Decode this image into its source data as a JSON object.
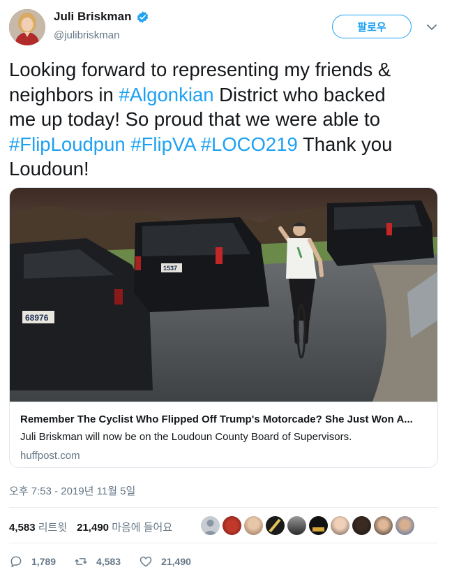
{
  "user": {
    "name": "Juli Briskman",
    "handle": "@julibriskman",
    "follow_label": "팔로우"
  },
  "tweet": {
    "lines": [
      [
        {
          "t": "Looking forward to representing my friends &"
        }
      ],
      [
        {
          "t": "neighbors in "
        },
        {
          "t": "#Algonkian",
          "link": true
        },
        {
          "t": " District who backed"
        }
      ],
      [
        {
          "t": "me up today! So proud  that we were able to"
        }
      ],
      [
        {
          "t": "#FlipLoudpun",
          "link": true
        },
        {
          "t": " "
        },
        {
          "t": "#FlipVA",
          "link": true
        },
        {
          "t": " "
        },
        {
          "t": "#LOCO219",
          "link": true
        },
        {
          "t": " Thank you"
        }
      ],
      [
        {
          "t": "Loudoun!"
        }
      ]
    ]
  },
  "card": {
    "title": "Remember The Cyclist Who Flipped Off Trump's Motorcade? She Just Won A...",
    "description": "Juli Briskman will now be on the Loudoun County Board of Supervisors.",
    "domain": "huffpost.com",
    "plates": [
      "68976",
      "1537"
    ]
  },
  "meta": {
    "timestamp": "오후 7:53 - 2019년 11월 5일"
  },
  "stats": {
    "retweets_count": "4,583",
    "retweets_label": "리트윗",
    "likes_count": "21,490",
    "likes_label": "마음에 들어요"
  },
  "actions": {
    "replies": "1,789",
    "retweets": "4,583",
    "likes": "21,490"
  },
  "colors": {
    "accent": "#1da1f2",
    "muted": "#657786",
    "text": "#14171a"
  }
}
